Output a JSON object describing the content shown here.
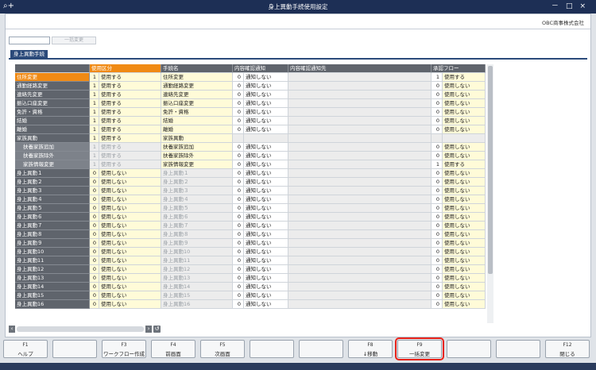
{
  "window": {
    "title": "身上異動手続使用設定",
    "icon": "search-plus-icon",
    "controls": [
      "－",
      "□",
      "×"
    ]
  },
  "company": "OBC商事株式会社",
  "toolbar": {
    "code_value": "",
    "bulk_label": "一括変更"
  },
  "tab": "身上異動手続",
  "headers": {
    "usage": "使用区分",
    "procedure": "手続名",
    "confirm_notice": "内容確認通知",
    "confirm_dest": "内容確認通知先",
    "approval": "承認フロー"
  },
  "rows": [
    {
      "name": "住所変更",
      "usage_code": "1",
      "usage": "使用する",
      "proc": "住所変更",
      "confirm_code": "0",
      "confirm": "通知しない",
      "appr_code": "1",
      "appr": "使用する"
    },
    {
      "name": "通勤経路変更",
      "usage_code": "1",
      "usage": "使用する",
      "proc": "通勤経路変更",
      "confirm_code": "0",
      "confirm": "通知しない",
      "appr_code": "0",
      "appr": "使用しない"
    },
    {
      "name": "連絡先変更",
      "usage_code": "1",
      "usage": "使用する",
      "proc": "連絡先変更",
      "confirm_code": "0",
      "confirm": "通知しない",
      "appr_code": "0",
      "appr": "使用しない"
    },
    {
      "name": "振込口座変更",
      "usage_code": "1",
      "usage": "使用する",
      "proc": "振込口座変更",
      "confirm_code": "0",
      "confirm": "通知しない",
      "appr_code": "0",
      "appr": "使用しない"
    },
    {
      "name": "免許・資格",
      "usage_code": "1",
      "usage": "使用する",
      "proc": "免許・資格",
      "confirm_code": "0",
      "confirm": "通知しない",
      "appr_code": "0",
      "appr": "使用しない"
    },
    {
      "name": "結婚",
      "usage_code": "1",
      "usage": "使用する",
      "proc": "結婚",
      "confirm_code": "0",
      "confirm": "通知しない",
      "appr_code": "0",
      "appr": "使用しない"
    },
    {
      "name": "離婚",
      "usage_code": "1",
      "usage": "使用する",
      "proc": "離婚",
      "confirm_code": "0",
      "confirm": "通知しない",
      "appr_code": "0",
      "appr": "使用しない"
    },
    {
      "name": "家族異動",
      "usage_code": "1",
      "usage": "使用する",
      "proc": "家族異動",
      "confirm_code": "",
      "confirm": "",
      "appr_code": "",
      "appr": ""
    },
    {
      "name": "扶養家族追加",
      "usage_code": "1",
      "usage": "使用する",
      "proc": "扶養家族追加",
      "confirm_code": "0",
      "confirm": "通知しない",
      "appr_code": "0",
      "appr": "使用しない"
    },
    {
      "name": "扶養家族除外",
      "usage_code": "1",
      "usage": "使用する",
      "proc": "扶養家族除外",
      "confirm_code": "0",
      "confirm": "通知しない",
      "appr_code": "0",
      "appr": "使用しない"
    },
    {
      "name": "家族情報変更",
      "usage_code": "1",
      "usage": "使用する",
      "proc": "家族情報変更",
      "confirm_code": "0",
      "confirm": "通知しない",
      "appr_code": "1",
      "appr": "使用する"
    },
    {
      "name": "身上異動１",
      "usage_code": "0",
      "usage": "使用しない",
      "proc": "身上異動１",
      "confirm_code": "0",
      "confirm": "通知しない",
      "appr_code": "0",
      "appr": "使用しない"
    },
    {
      "name": "身上異動２",
      "usage_code": "0",
      "usage": "使用しない",
      "proc": "身上異動２",
      "confirm_code": "0",
      "confirm": "通知しない",
      "appr_code": "0",
      "appr": "使用しない"
    },
    {
      "name": "身上異動３",
      "usage_code": "0",
      "usage": "使用しない",
      "proc": "身上異動３",
      "confirm_code": "0",
      "confirm": "通知しない",
      "appr_code": "0",
      "appr": "使用しない"
    },
    {
      "name": "身上異動４",
      "usage_code": "0",
      "usage": "使用しない",
      "proc": "身上異動４",
      "confirm_code": "0",
      "confirm": "通知しない",
      "appr_code": "0",
      "appr": "使用しない"
    },
    {
      "name": "身上異動５",
      "usage_code": "0",
      "usage": "使用しない",
      "proc": "身上異動５",
      "confirm_code": "0",
      "confirm": "通知しない",
      "appr_code": "0",
      "appr": "使用しない"
    },
    {
      "name": "身上異動６",
      "usage_code": "0",
      "usage": "使用しない",
      "proc": "身上異動６",
      "confirm_code": "0",
      "confirm": "通知しない",
      "appr_code": "0",
      "appr": "使用しない"
    },
    {
      "name": "身上異動７",
      "usage_code": "0",
      "usage": "使用しない",
      "proc": "身上異動７",
      "confirm_code": "0",
      "confirm": "通知しない",
      "appr_code": "0",
      "appr": "使用しない"
    },
    {
      "name": "身上異動８",
      "usage_code": "0",
      "usage": "使用しない",
      "proc": "身上異動８",
      "confirm_code": "0",
      "confirm": "通知しない",
      "appr_code": "0",
      "appr": "使用しない"
    },
    {
      "name": "身上異動９",
      "usage_code": "0",
      "usage": "使用しない",
      "proc": "身上異動９",
      "confirm_code": "0",
      "confirm": "通知しない",
      "appr_code": "0",
      "appr": "使用しない"
    },
    {
      "name": "身上異動10",
      "usage_code": "0",
      "usage": "使用しない",
      "proc": "身上異動10",
      "confirm_code": "0",
      "confirm": "通知しない",
      "appr_code": "0",
      "appr": "使用しない"
    },
    {
      "name": "身上異動11",
      "usage_code": "0",
      "usage": "使用しない",
      "proc": "身上異動11",
      "confirm_code": "0",
      "confirm": "通知しない",
      "appr_code": "0",
      "appr": "使用しない"
    },
    {
      "name": "身上異動12",
      "usage_code": "0",
      "usage": "使用しない",
      "proc": "身上異動12",
      "confirm_code": "0",
      "confirm": "通知しない",
      "appr_code": "0",
      "appr": "使用しない"
    },
    {
      "name": "身上異動13",
      "usage_code": "0",
      "usage": "使用しない",
      "proc": "身上異動13",
      "confirm_code": "0",
      "confirm": "通知しない",
      "appr_code": "0",
      "appr": "使用しない"
    },
    {
      "name": "身上異動14",
      "usage_code": "0",
      "usage": "使用しない",
      "proc": "身上異動14",
      "confirm_code": "0",
      "confirm": "通知しない",
      "appr_code": "0",
      "appr": "使用しない"
    },
    {
      "name": "身上異動15",
      "usage_code": "0",
      "usage": "使用しない",
      "proc": "身上異動15",
      "confirm_code": "0",
      "confirm": "通知しない",
      "appr_code": "0",
      "appr": "使用しない"
    },
    {
      "name": "身上異動16",
      "usage_code": "0",
      "usage": "使用しない",
      "proc": "身上異動16",
      "confirm_code": "0",
      "confirm": "通知しない",
      "appr_code": "0",
      "appr": "使用しない"
    }
  ],
  "fkeys": [
    {
      "key": "F1",
      "label": "ヘルプ"
    },
    {
      "key": "",
      "label": ""
    },
    {
      "key": "F3",
      "label": "ワークフロー作成"
    },
    {
      "key": "F4",
      "label": "前画面"
    },
    {
      "key": "F5",
      "label": "次画面"
    },
    {
      "key": "",
      "label": ""
    },
    {
      "key": "",
      "label": ""
    },
    {
      "key": "F8",
      "label": "↓移動"
    },
    {
      "key": "F9",
      "label": "一括変更"
    },
    {
      "key": "",
      "label": ""
    },
    {
      "key": "",
      "label": ""
    },
    {
      "key": "F12",
      "label": "閉じる"
    }
  ],
  "colors": {
    "title_bar": "#1d2f55",
    "selected_header": "#f08a14",
    "highlight_outline": "#e8231a",
    "editable_cell": "#fffbd8"
  }
}
